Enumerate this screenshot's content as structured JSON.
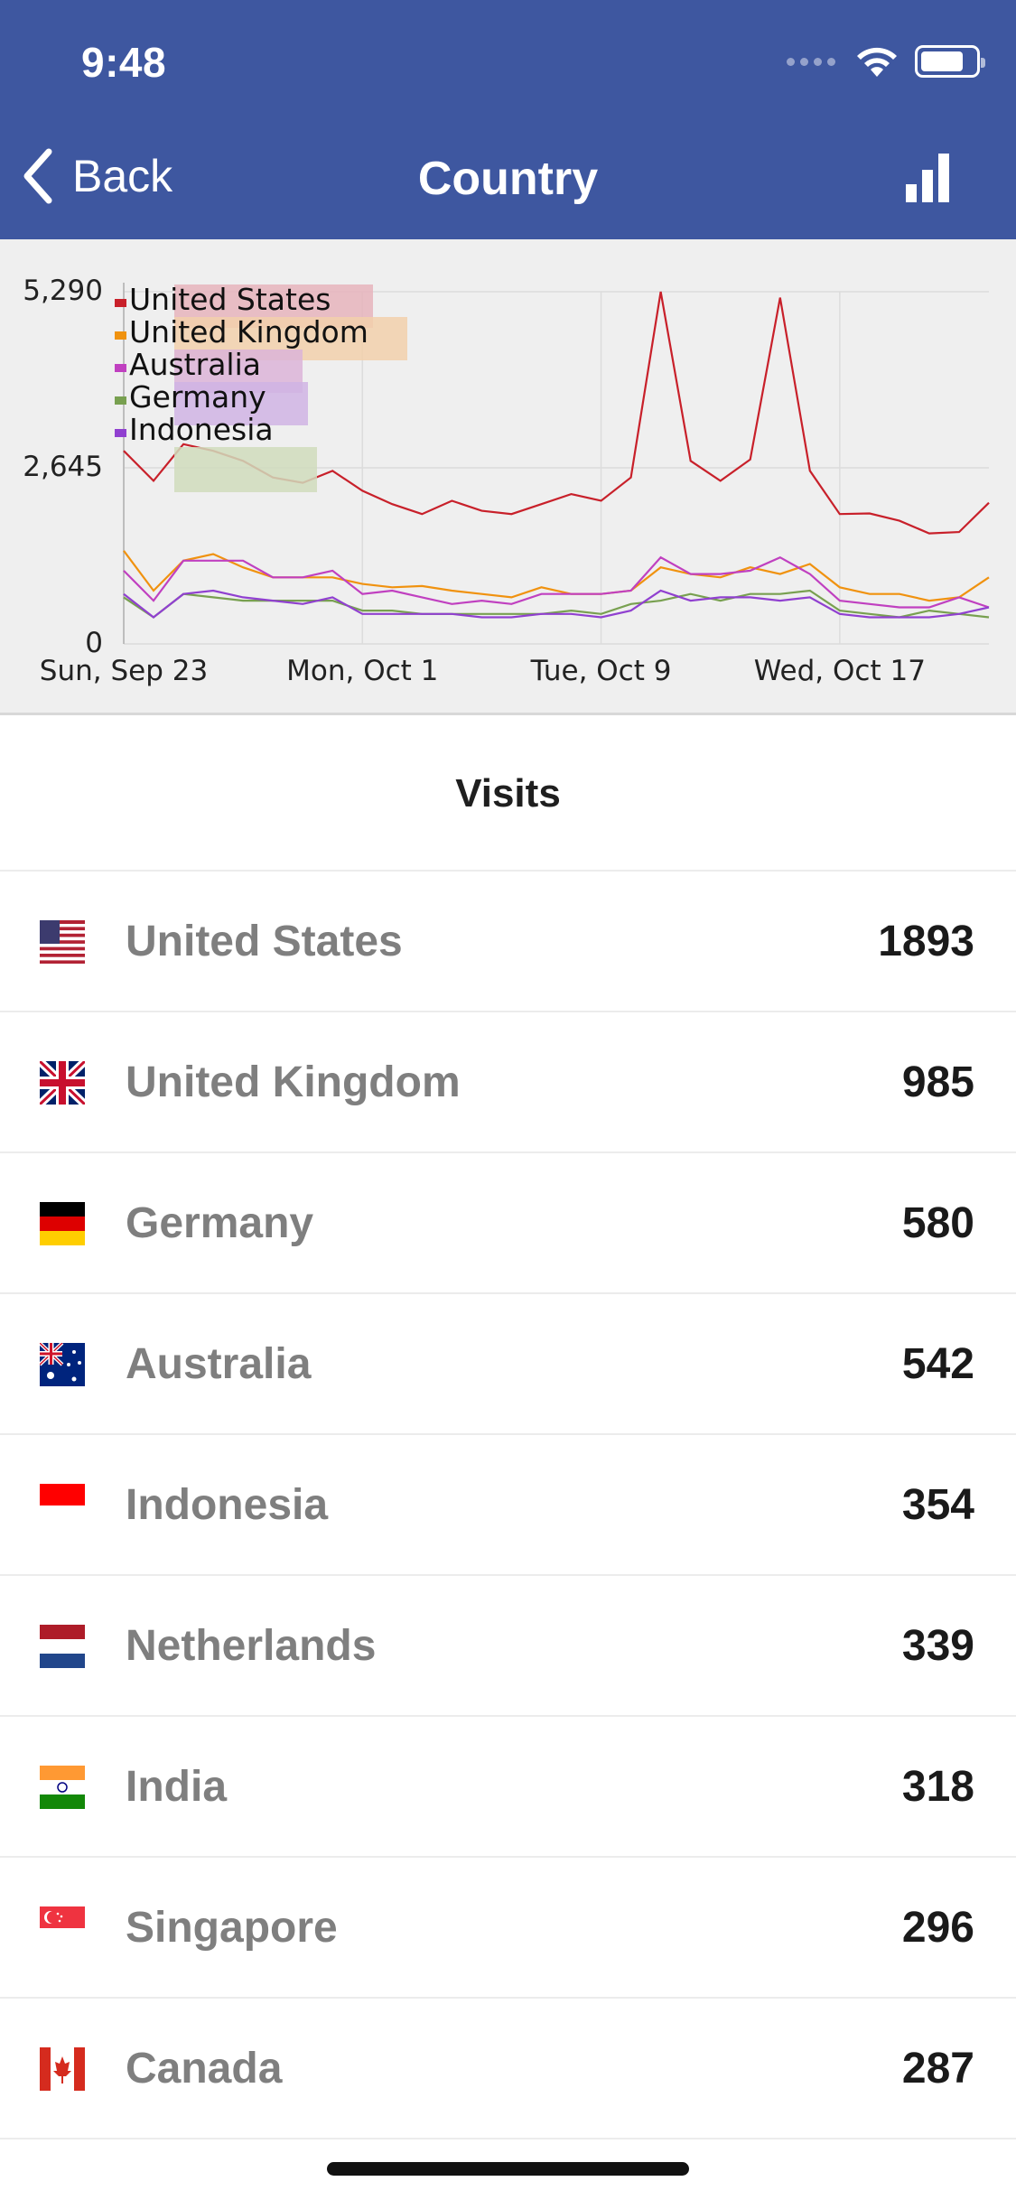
{
  "status_bar": {
    "time": "9:48"
  },
  "nav": {
    "back_label": "Back",
    "title": "Country",
    "chart_icon": "bar-chart-icon"
  },
  "chart_data": {
    "type": "line",
    "y_ticks": [
      "5,290",
      "2,645",
      "0"
    ],
    "ylim": [
      0,
      5290
    ],
    "x_tick_labels": [
      "Sun, Sep 23",
      "Mon, Oct 1",
      "Tue, Oct 9",
      "Wed, Oct 17"
    ],
    "x_tick_index": [
      0,
      8,
      16,
      24
    ],
    "grid": true,
    "legend_position": "top-left",
    "series": [
      {
        "name": "United States",
        "color": "#c8202a",
        "values": [
          2900,
          2450,
          3000,
          2900,
          2750,
          2500,
          2420,
          2600,
          2300,
          2100,
          1950,
          2150,
          2000,
          1950,
          2100,
          2250,
          2150,
          2500,
          5290,
          2750,
          2450,
          2770,
          5200,
          2600,
          1950,
          1960,
          1850,
          1660,
          1680,
          2120
        ]
      },
      {
        "name": "United Kingdom",
        "color": "#f0920f",
        "values": [
          1400,
          800,
          1250,
          1350,
          1150,
          1000,
          1000,
          1000,
          900,
          850,
          870,
          800,
          750,
          700,
          850,
          750,
          750,
          800,
          1150,
          1050,
          1000,
          1150,
          1050,
          1200,
          850,
          750,
          750,
          650,
          700,
          1000
        ]
      },
      {
        "name": "Australia",
        "color": "#c040c0",
        "values": [
          1100,
          650,
          1250,
          1250,
          1250,
          1000,
          1000,
          1100,
          750,
          800,
          700,
          600,
          650,
          600,
          750,
          750,
          750,
          800,
          1300,
          1050,
          1050,
          1100,
          1300,
          1050,
          650,
          600,
          550,
          550,
          700,
          550
        ]
      },
      {
        "name": "Germany",
        "color": "#78a050",
        "values": [
          700,
          400,
          750,
          700,
          650,
          650,
          650,
          650,
          500,
          500,
          450,
          450,
          450,
          450,
          450,
          500,
          450,
          600,
          650,
          750,
          650,
          750,
          750,
          800,
          500,
          450,
          400,
          500,
          450,
          400
        ]
      },
      {
        "name": "Indonesia",
        "color": "#9040d0",
        "values": [
          750,
          400,
          750,
          800,
          700,
          650,
          600,
          700,
          450,
          450,
          450,
          450,
          400,
          400,
          450,
          450,
          400,
          500,
          800,
          650,
          700,
          700,
          650,
          700,
          450,
          400,
          400,
          400,
          450,
          550
        ]
      }
    ],
    "legend_swatches": [
      "#e6b4bc",
      "#f2d0ac",
      "#dcb4d8",
      "#d0b4e4",
      "#d0dcbc"
    ]
  },
  "visits": {
    "title": "Visits",
    "rows": [
      {
        "country": "United States",
        "count": "1893",
        "flag": "us-flag-icon"
      },
      {
        "country": "United Kingdom",
        "count": "985",
        "flag": "uk-flag-icon"
      },
      {
        "country": "Germany",
        "count": "580",
        "flag": "germany-flag-icon"
      },
      {
        "country": "Australia",
        "count": "542",
        "flag": "australia-flag-icon"
      },
      {
        "country": "Indonesia",
        "count": "354",
        "flag": "indonesia-flag-icon"
      },
      {
        "country": "Netherlands",
        "count": "339",
        "flag": "netherlands-flag-icon"
      },
      {
        "country": "India",
        "count": "318",
        "flag": "india-flag-icon"
      },
      {
        "country": "Singapore",
        "count": "296",
        "flag": "singapore-flag-icon"
      },
      {
        "country": "Canada",
        "count": "287",
        "flag": "canada-flag-icon"
      }
    ]
  },
  "colors": {
    "header": "#3e57a0",
    "chart_bg": "#efefef"
  }
}
